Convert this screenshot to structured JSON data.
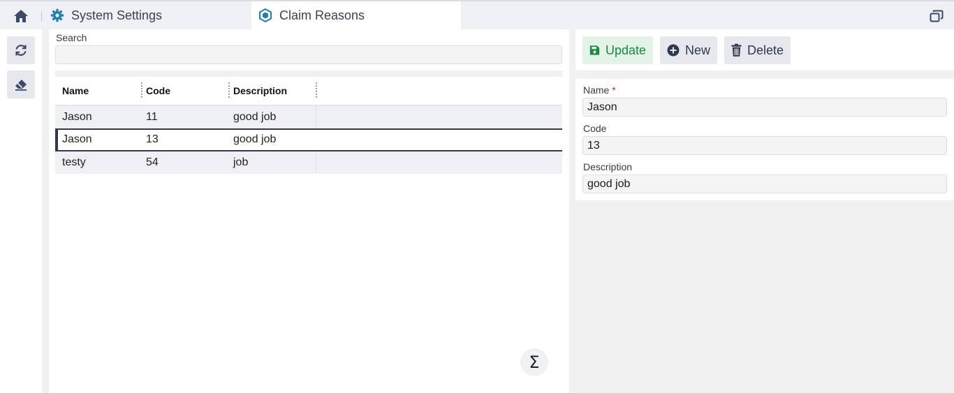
{
  "tabs": [
    {
      "label": "System Settings",
      "icon": "gear-icon"
    },
    {
      "label": "Claim Reasons",
      "icon": "hexagon-icon"
    }
  ],
  "search": {
    "label": "Search",
    "value": ""
  },
  "grid": {
    "columns": [
      "Name",
      "Code",
      "Description"
    ],
    "rows": [
      {
        "name": "Jason",
        "code": "11",
        "description": "good job"
      },
      {
        "name": "Jason",
        "code": "13",
        "description": "good job",
        "selected": true
      },
      {
        "name": "testy",
        "code": "54",
        "description": "job"
      }
    ]
  },
  "summary_icon": "Σ",
  "toolbar": {
    "update_label": "Update",
    "new_label": "New",
    "delete_label": "Delete"
  },
  "form": {
    "name_label": "Name",
    "required_mark": "*",
    "name_value": "Jason",
    "code_label": "Code",
    "code_value": "13",
    "description_label": "Description",
    "description_value": "good job"
  },
  "colors": {
    "accent": "#2c3a52",
    "update_green": "#1b8a3c",
    "tab_icon_blue": "#1f7fb5"
  }
}
